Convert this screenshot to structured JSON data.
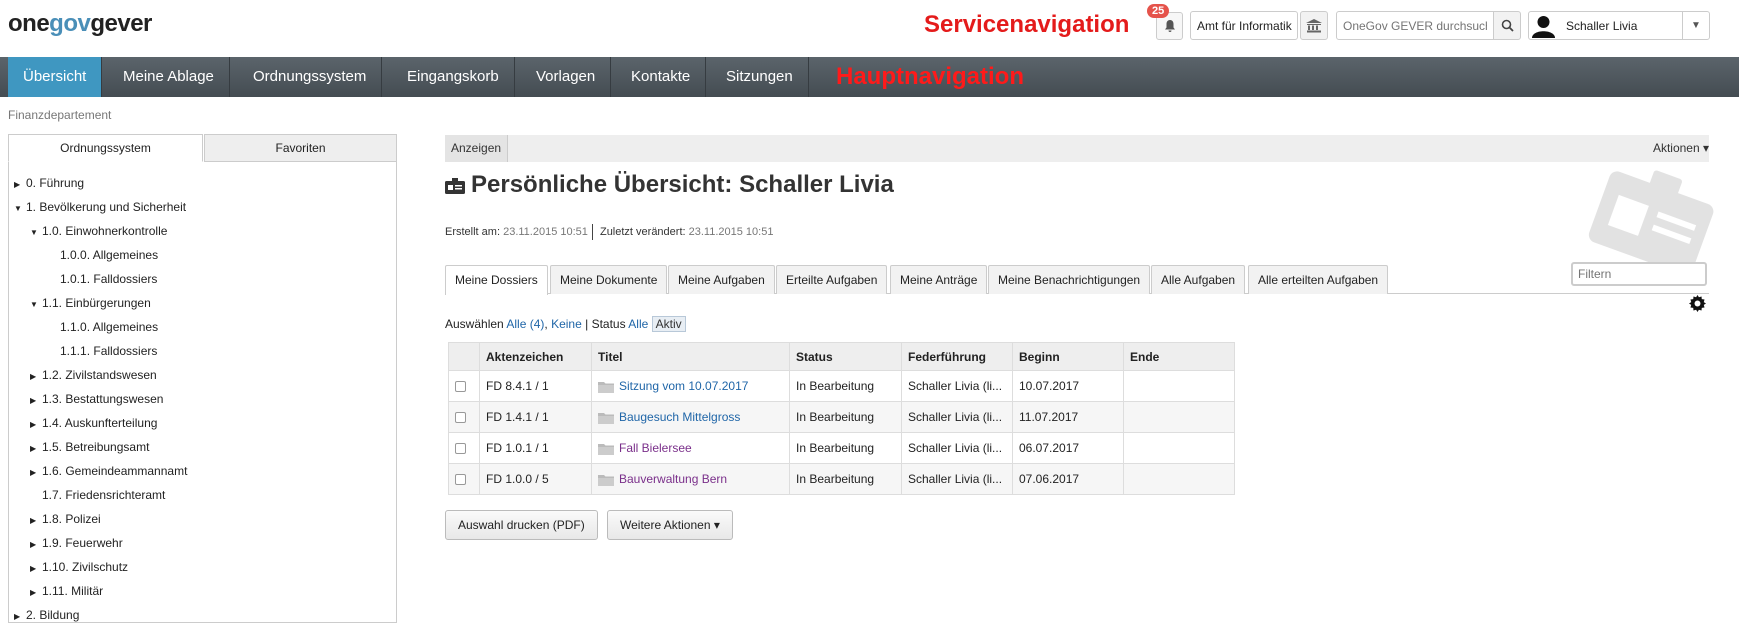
{
  "header": {
    "logo": {
      "part1": "one",
      "part2": "gov",
      "part3": "gever"
    },
    "service_label": "Servicenavigation",
    "notifications_count": "25",
    "org_unit": "Amt für Informatik",
    "search_placeholder": "OneGov GEVER durchsuchen",
    "user_name": "Schaller Livia"
  },
  "mainnav": {
    "items": [
      "Übersicht",
      "Meine Ablage",
      "Ordnungssystem",
      "Eingangskorb",
      "Vorlagen",
      "Kontakte",
      "Sitzungen"
    ],
    "label": "Hauptnavigation"
  },
  "breadcrumb": "Finanzdepartement",
  "sidebar": {
    "tabs": [
      "Ordnungssystem",
      "Favoriten"
    ],
    "tree": [
      {
        "label": "0. Führung",
        "arrow": "▶"
      },
      {
        "label": "1. Bevölkerung und Sicherheit",
        "arrow": "▼"
      },
      {
        "label": "1.0. Einwohnerkontrolle",
        "arrow": "▼"
      },
      {
        "label": "1.0.0. Allgemeines",
        "arrow": ""
      },
      {
        "label": "1.0.1. Falldossiers",
        "arrow": ""
      },
      {
        "label": "1.1. Einbürgerungen",
        "arrow": "▼"
      },
      {
        "label": "1.1.0. Allgemeines",
        "arrow": ""
      },
      {
        "label": "1.1.1. Falldossiers",
        "arrow": ""
      },
      {
        "label": "1.2. Zivilstandswesen",
        "arrow": "▶"
      },
      {
        "label": "1.3. Bestattungswesen",
        "arrow": "▶"
      },
      {
        "label": "1.4. Auskunfterteilung",
        "arrow": "▶"
      },
      {
        "label": "1.5. Betreibungsamt",
        "arrow": "▶"
      },
      {
        "label": "1.6. Gemeindeammannamt",
        "arrow": "▶"
      },
      {
        "label": "1.7. Friedensrichteramt",
        "arrow": ""
      },
      {
        "label": "1.8. Polizei",
        "arrow": "▶"
      },
      {
        "label": "1.9. Feuerwehr",
        "arrow": "▶"
      },
      {
        "label": "1.10. Zivilschutz",
        "arrow": "▶"
      },
      {
        "label": "1.11. Militär",
        "arrow": "▶"
      },
      {
        "label": "2. Bildung",
        "arrow": "▶"
      }
    ]
  },
  "content": {
    "view_tab": "Anzeigen",
    "actions_label": "Aktionen ▾",
    "title": "Persönliche Übersicht: Schaller Livia",
    "created_label": "Erstellt am:",
    "created_value": "23.11.2015 10:51",
    "modified_label": "Zuletzt verändert:",
    "modified_value": "23.11.2015 10:51",
    "filter_placeholder": "Filtern",
    "tabs": [
      "Meine Dossiers",
      "Meine Dokumente",
      "Meine Aufgaben",
      "Erteilte Aufgaben",
      "Meine Anträge",
      "Meine Benachrichtigungen",
      "Alle Aufgaben",
      "Alle erteilten Aufgaben"
    ],
    "select": {
      "label": "Auswählen",
      "all": "Alle (4)",
      "none": "Keine",
      "status_label": "Status",
      "status_all": "Alle",
      "status_active": "Aktiv"
    },
    "table": {
      "columns": [
        "Aktenzeichen",
        "Titel",
        "Status",
        "Federführung",
        "Beginn",
        "Ende"
      ],
      "rows": [
        {
          "ref": "FD 8.4.1 / 1",
          "title": "Sitzung vom 10.07.2017",
          "status": "In Bearbeitung",
          "owner": "Schaller Livia (li...",
          "start": "10.07.2017",
          "end": ""
        },
        {
          "ref": "FD 1.4.1 / 1",
          "title": "Baugesuch Mittelgross",
          "status": "In Bearbeitung",
          "owner": "Schaller Livia (li...",
          "start": "11.07.2017",
          "end": ""
        },
        {
          "ref": "FD 1.0.1 / 1",
          "title": "Fall Bielersee",
          "status": "In Bearbeitung",
          "owner": "Schaller Livia (li...",
          "start": "06.07.2017",
          "end": ""
        },
        {
          "ref": "FD 1.0.0 / 5",
          "title": "Bauverwaltung Bern",
          "status": "In Bearbeitung",
          "owner": "Schaller Livia (li...",
          "start": "07.06.2017",
          "end": ""
        }
      ]
    },
    "buttons": {
      "print": "Auswahl drucken (PDF)",
      "more": "Weitere Aktionen ▾"
    }
  },
  "colors": {
    "nav_active": "#3f97c1",
    "annotation_red": "#e41b1b",
    "link_blue": "#2066a8",
    "link_visited": "#7a2f8a"
  }
}
